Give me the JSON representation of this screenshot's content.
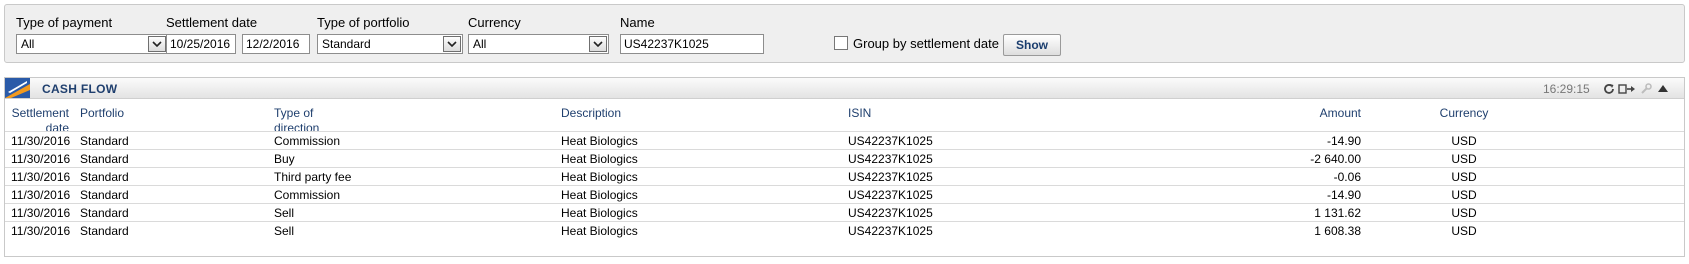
{
  "filters": {
    "type_of_payment": {
      "label": "Type of payment",
      "value": "All"
    },
    "settlement_date": {
      "label": "Settlement date",
      "from": "10/25/2016",
      "separator": "-",
      "to": "12/2/2016"
    },
    "type_of_portfolio": {
      "label": "Type of portfolio",
      "value": "Standard"
    },
    "currency": {
      "label": "Currency",
      "value": "All"
    },
    "name": {
      "label": "Name",
      "value": "US42237K1025"
    },
    "group_by_settlement": {
      "label": "Group by settlement date",
      "checked": false
    },
    "show_label": "Show"
  },
  "panel": {
    "title": "CASH FLOW",
    "time": "16:29:15",
    "icons": [
      "refresh-icon",
      "export-icon",
      "settings-icon",
      "collapse-icon"
    ],
    "columns": {
      "settlement_line1": "Settlement",
      "settlement_line2": "date",
      "portfolio": "Portfolio",
      "direction_line1": "Type of",
      "direction_line2": "direction",
      "description": "Description",
      "isin": "ISIN",
      "amount": "Amount",
      "currency": "Currency"
    },
    "rows": [
      {
        "date": "11/30/2016",
        "portfolio": "Standard",
        "direction": "Commission",
        "description": "Heat Biologics",
        "isin": "US42237K1025",
        "amount": "-14.90",
        "currency": "USD"
      },
      {
        "date": "11/30/2016",
        "portfolio": "Standard",
        "direction": "Buy",
        "description": "Heat Biologics",
        "isin": "US42237K1025",
        "amount": "-2 640.00",
        "currency": "USD"
      },
      {
        "date": "11/30/2016",
        "portfolio": "Standard",
        "direction": "Third party fee",
        "description": "Heat Biologics",
        "isin": "US42237K1025",
        "amount": "-0.06",
        "currency": "USD"
      },
      {
        "date": "11/30/2016",
        "portfolio": "Standard",
        "direction": "Commission",
        "description": "Heat Biologics",
        "isin": "US42237K1025",
        "amount": "-14.90",
        "currency": "USD"
      },
      {
        "date": "11/30/2016",
        "portfolio": "Standard",
        "direction": "Sell",
        "description": "Heat Biologics",
        "isin": "US42237K1025",
        "amount": "1 131.62",
        "currency": "USD"
      },
      {
        "date": "11/30/2016",
        "portfolio": "Standard",
        "direction": "Sell",
        "description": "Heat Biologics",
        "isin": "US42237K1025",
        "amount": "1 608.38",
        "currency": "USD"
      }
    ]
  }
}
